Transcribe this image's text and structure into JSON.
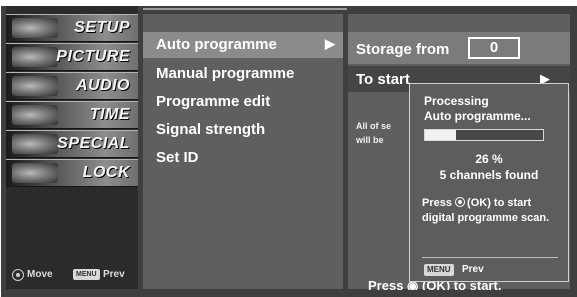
{
  "left_menu": {
    "items": [
      {
        "label": "SETUP",
        "icon": "setup-icon"
      },
      {
        "label": "PICTURE",
        "icon": "picture-icon"
      },
      {
        "label": "AUDIO",
        "icon": "audio-icon"
      },
      {
        "label": "TIME",
        "icon": "time-icon"
      },
      {
        "label": "SPECIAL",
        "icon": "special-icon"
      },
      {
        "label": "LOCK",
        "icon": "lock-icon"
      }
    ],
    "footer": {
      "move_label": "Move",
      "menu_key": "MENU",
      "prev_label": "Prev"
    }
  },
  "mid_menu": {
    "items": [
      {
        "label": "Auto programme",
        "selected": true
      },
      {
        "label": "Manual programme"
      },
      {
        "label": "Programme edit"
      },
      {
        "label": "Signal strength"
      },
      {
        "label": "Set ID"
      }
    ],
    "arrow": "▶"
  },
  "right_panel": {
    "storage_label": "Storage from",
    "storage_value": "0",
    "to_start_label": "To start",
    "to_start_arrow": "▶",
    "info_line1": "All of se",
    "info_line2": "will be",
    "bottom_press": "Press ◉ (OK) to start."
  },
  "popup": {
    "title_line1": "Processing",
    "title_line2": "Auto programme...",
    "progress": 0.26,
    "percent_text": "26 %",
    "channels_found": "5 channels found",
    "press_line1": "(OK) to start",
    "press_word": "Press",
    "press_line2": "digital programme scan.",
    "menu_key": "MENU",
    "prev_label": "Prev"
  },
  "colors": {
    "background": "#3f3f3f",
    "panel": "#5f5f5f",
    "selected": "#8b8b8b"
  }
}
